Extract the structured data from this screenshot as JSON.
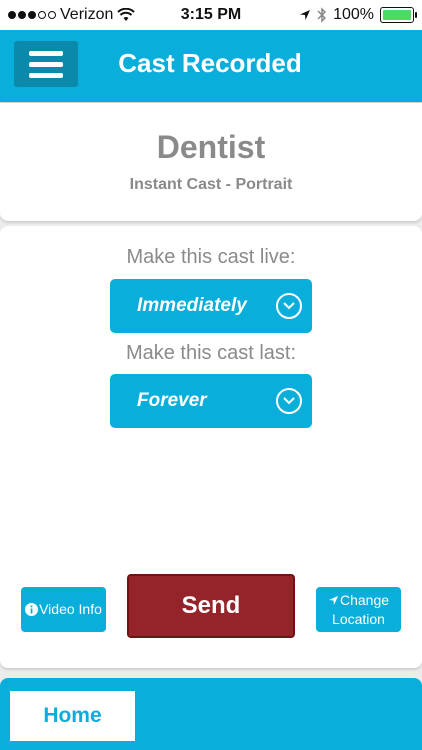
{
  "status_bar": {
    "carrier": "Verizon",
    "time": "3:15 PM",
    "battery": "100%",
    "signal_bars_filled": 3,
    "signal_bars_total": 5
  },
  "header": {
    "title": "Cast Recorded",
    "menu_icon": "hamburger-menu-icon"
  },
  "cast": {
    "name": "Dentist",
    "type": "Instant Cast - Portrait"
  },
  "schedule": {
    "live_label": "Make this cast live:",
    "live_value": "Immediately",
    "last_label": "Make this cast last:",
    "last_value": "Forever"
  },
  "actions": {
    "video_info": "Video Info",
    "send": "Send",
    "change_location_line1": "Change",
    "change_location_line2": "Location"
  },
  "nav": {
    "home": "Home"
  },
  "colors": {
    "accent": "#09aedb",
    "accent_dark": "#0b89ab",
    "send": "#95242a",
    "text_gray": "#8a8a8a"
  }
}
